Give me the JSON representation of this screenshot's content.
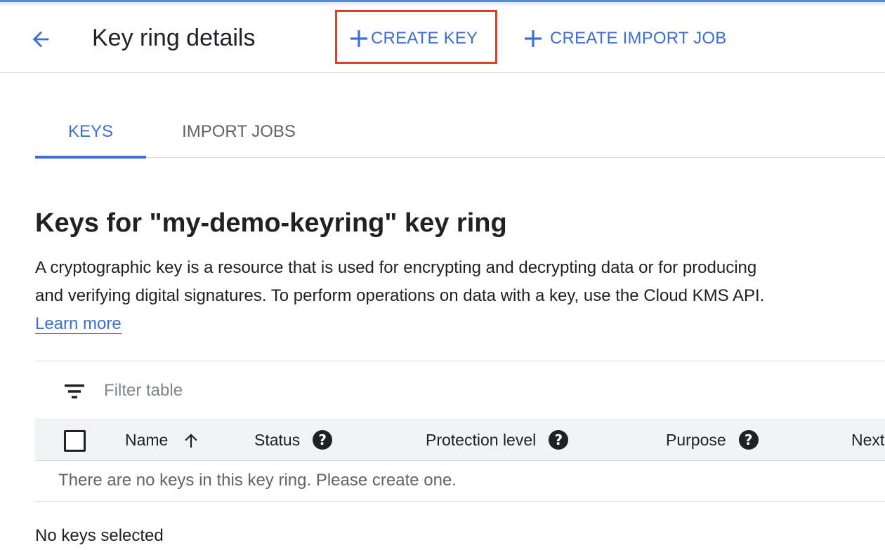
{
  "header": {
    "title": "Key ring details",
    "back_icon": "arrow-back-icon",
    "actions": {
      "create_key": "CREATE KEY",
      "create_import_job": "CREATE IMPORT JOB"
    }
  },
  "tabs": [
    {
      "label": "KEYS",
      "active": true
    },
    {
      "label": "IMPORT JOBS",
      "active": false
    }
  ],
  "section": {
    "title": "Keys for \"my-demo-keyring\" key ring",
    "description": "A cryptographic key is a resource that is used for encrypting and decrypting data or for producing and verifying digital signatures. To perform operations on data with a key, use the Cloud KMS API.",
    "learn_more": "Learn more"
  },
  "table": {
    "filter_placeholder": "Filter table",
    "columns": [
      "Name",
      "Status",
      "Protection level",
      "Purpose",
      "Next"
    ],
    "sort_column": "Name",
    "sort_direction": "ascending",
    "empty_message": "There are no keys in this key ring. Please create one."
  },
  "footer": {
    "selection_status": "No keys selected"
  },
  "colors": {
    "accent": "#3c6fd1",
    "highlight_box": "#d8432b",
    "header_row_bg": "#f1f3f4"
  }
}
